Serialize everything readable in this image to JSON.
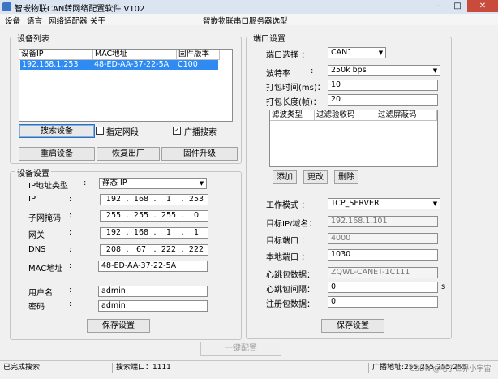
{
  "window": {
    "title": "智嵌物联CAN转网络配置软件   V102",
    "minimize": "–",
    "maximize": "□",
    "close": "✕"
  },
  "menu": {
    "items": [
      "设备",
      "语言",
      "网络适配器",
      "关于"
    ],
    "center": "智嵌物联串口服务器选型"
  },
  "device_list": {
    "title": "设备列表",
    "columns": [
      "设备IP",
      "MAC地址",
      "固件版本"
    ],
    "rows": [
      {
        "ip": "192.168.1.253",
        "mac": "48-ED-AA-37-22-5A",
        "fw": "C100"
      }
    ],
    "search_button": "搜索设备",
    "specify_segment": "指定网段",
    "specify_checked": false,
    "broadcast": "广播搜索",
    "broadcast_checked": true,
    "restart_button": "重启设备",
    "factory_button": "恢复出厂",
    "upgrade_button": "固件升级"
  },
  "device_settings": {
    "title": "设备设置",
    "ip_type_label": "IP地址类型",
    "ip_type_value": "静态 IP",
    "ip_label": "IP",
    "ip_value": [
      "192",
      "168",
      "1",
      "253"
    ],
    "mask_label": "子网掩码",
    "mask_value": [
      "255",
      "255",
      "255",
      "0"
    ],
    "gateway_label": "网关",
    "gateway_value": [
      "192",
      "168",
      "1",
      "1"
    ],
    "dns_label": "DNS",
    "dns_value": [
      "208",
      "67",
      "222",
      "222"
    ],
    "mac_label": "MAC地址",
    "mac_value": "48-ED-AA-37-22-5A",
    "user_label": "用户名",
    "user_value": "admin",
    "pwd_label": "密码",
    "pwd_value": "admin",
    "colon": ":",
    "save_button": "保存设置"
  },
  "port_settings": {
    "title": "端口设置",
    "port_label": "端口选择 ：",
    "port_value": "CAN1",
    "baud_label": "波特率",
    "baud_colon": ":",
    "baud_value": "250k  bps",
    "pack_time_label": "打包时间(ms)：",
    "pack_time_value": "10",
    "pack_len_label": "打包长度(帧)：",
    "pack_len_value": "20",
    "filter_columns": [
      "滤波类型",
      "过滤验收码",
      "过滤屏蔽码"
    ],
    "add_button": "添加",
    "edit_button": "更改",
    "delete_button": "删除",
    "mode_label": "工作模式 ：",
    "mode_value": "TCP_SERVER",
    "target_ip_label": "目标IP/域名：",
    "target_ip_value": "192.168.1.101",
    "target_port_label": "目标端口 ：",
    "target_port_value": "4000",
    "local_port_label": "本地端口 ：",
    "local_port_value": "1030",
    "heartbeat_label": "心跳包数据：",
    "heartbeat_value": "ZQWL-CANET-1C111",
    "heartbeat_interval_label": "心跳包间隔：",
    "heartbeat_interval_value": "0",
    "heartbeat_interval_unit": "s",
    "register_label": "注册包数据：",
    "register_value": "0",
    "save_button": "保存设置"
  },
  "one_click_button": "一键配置",
  "status": {
    "left": "已完成搜索",
    "search_port": "搜索端口：1111",
    "broadcast": "广播地址:255.255.255.255",
    "watermark": "CSDN @电子世界小宇宙"
  },
  "colors": {
    "selection": "#2f8bf2",
    "window_bg": "#f0f0f0",
    "close": "#c94b3c"
  }
}
